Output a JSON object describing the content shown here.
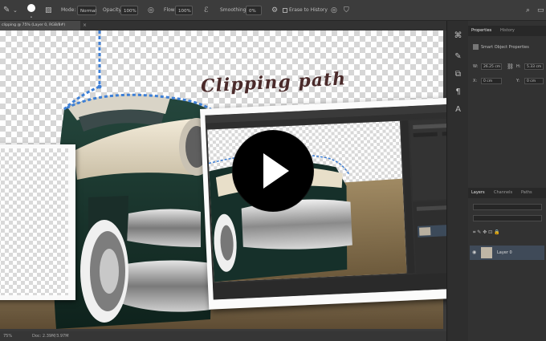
{
  "options_bar": {
    "label_mode": "Mode:",
    "mode_value": "Normal",
    "label_opacity": "Opacity:",
    "opacity_value": "100%",
    "label_flow": "Flow:",
    "flow_value": "100%",
    "label_smoothing": "Smoothing:",
    "smoothing_value": "0%",
    "sample_history": "Erase to History"
  },
  "document_tab": {
    "title": "clipping @ 75% (Layer 0, RGB/8#)"
  },
  "status_bar": {
    "zoom": "75%",
    "doc_info": "Doc: 2.39M/3.97M"
  },
  "properties_panel": {
    "tab_properties": "Properties",
    "tab_history": "History",
    "layer_kind": "Smart Object Properties",
    "w_label": "W:",
    "w_value": "26.25 cm",
    "h_label": "H:",
    "h_value": "5.33 cm",
    "x_label": "X:",
    "x_value": "0 cm",
    "y_label": "Y:",
    "y_value": "0 cm"
  },
  "layers_panel": {
    "tab_layers": "Layers",
    "tab_channels": "Channels",
    "tab_paths": "Paths",
    "layer_name": "Layer 0"
  },
  "overlay": {
    "headline": "Clipping path"
  },
  "colors": {
    "panel_bg": "#323232",
    "options_bg": "#3c3c3c",
    "path_blue": "#3d7fd6",
    "headline": "#4a2a2a"
  }
}
